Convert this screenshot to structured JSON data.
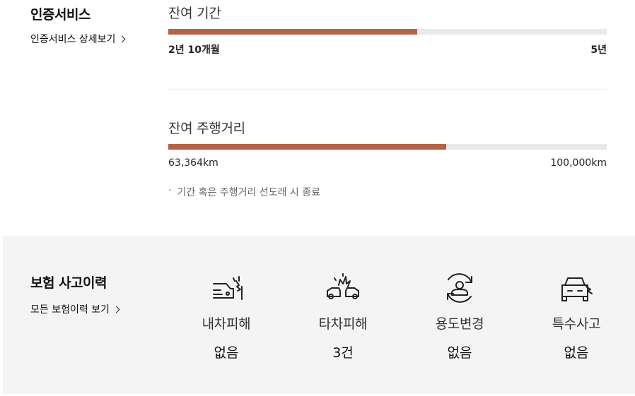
{
  "certification": {
    "title": "인증서비스",
    "detail_link": "인증서비스 상세보기",
    "period": {
      "title": "잔여 기간",
      "current": "2년 10개월",
      "max": "5년",
      "progress": 0.567
    },
    "mileage": {
      "title": "잔여 주행거리",
      "current": "63,364km",
      "max": "100,000km",
      "progress": 0.634
    },
    "note_bullet": "·",
    "note": "기간 혹은 주행거리 선도래 시 종료"
  },
  "insurance": {
    "title": "보험 사고이력",
    "detail_link": "모든 보험이력 보기",
    "items": [
      {
        "icon": "own-car-damage-icon",
        "label": "내차피해",
        "value": "없음"
      },
      {
        "icon": "other-car-damage-icon",
        "label": "타차피해",
        "value": "3건"
      },
      {
        "icon": "usage-change-icon",
        "label": "용도변경",
        "value": "없음"
      },
      {
        "icon": "special-accident-icon",
        "label": "특수사고",
        "value": "없음"
      }
    ]
  },
  "colors": {
    "progress_fill": "#b26449",
    "progress_track": "#e9e9e9",
    "panel_bg": "#f4f4f4"
  }
}
